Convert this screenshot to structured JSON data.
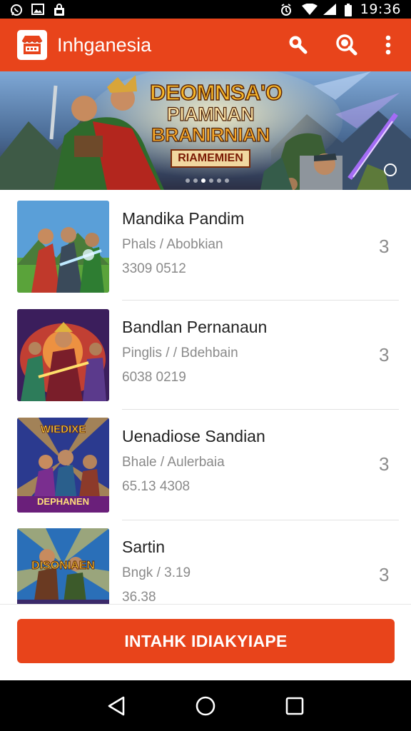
{
  "status_bar": {
    "time": "19:36",
    "left_icons": [
      "whatsapp-icon",
      "image-icon",
      "bag-icon"
    ],
    "right_icons": [
      "alarm-icon",
      "wifi-icon",
      "signal-icon",
      "battery-icon"
    ]
  },
  "app_bar": {
    "title": "Inhganesia",
    "logo": "shop-logo-icon",
    "actions": [
      "search-icon",
      "search-zoom-icon",
      "more-vert-icon"
    ]
  },
  "banner": {
    "title_line1": "DEOMNSA'O",
    "title_line2": "PIAMNAN",
    "title_line3": "BRANIRNIAN",
    "subtitle": "RIAMEMIEN",
    "pager_total": 6,
    "pager_active": 2
  },
  "items": [
    {
      "title": "Mandika Pandim",
      "subtitle": "Phals / Abobkian",
      "meta": "3309  0512",
      "count": "3"
    },
    {
      "title": "Bandlan Pernanaun",
      "subtitle": "Pinglis / / Bdehbain",
      "meta": "6038  0219",
      "count": "3"
    },
    {
      "title": "Uenadiose Sandian",
      "subtitle": "Bhale / Aulerbaia",
      "meta": "65.13  4308",
      "count": "3"
    },
    {
      "title": "Sartin",
      "subtitle": "Bngk / 3.19",
      "meta": "36.38",
      "count": "3"
    }
  ],
  "thumb_labels": {
    "item3": "WIEDIXE",
    "item3_bottom": "DEPHANEN",
    "item4": "DISONIAEN"
  },
  "primary_action": {
    "label": "INTAHK IDIAKYIAPE"
  },
  "nav": [
    "back-icon",
    "home-icon",
    "recents-icon"
  ],
  "colors": {
    "accent": "#e8441b",
    "status_bar": "#000000",
    "nav_bar": "#000000"
  }
}
